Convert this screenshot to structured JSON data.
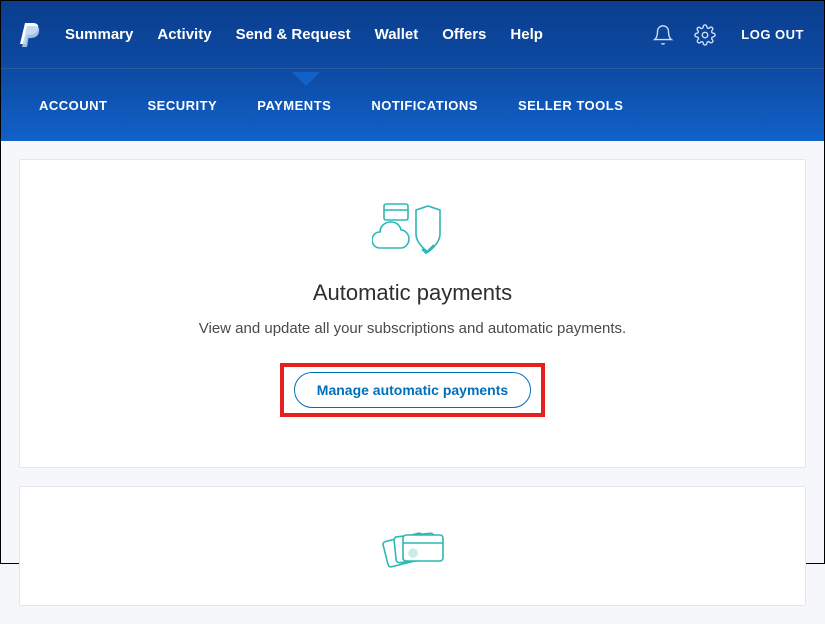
{
  "topNav": {
    "items": [
      "Summary",
      "Activity",
      "Send & Request",
      "Wallet",
      "Offers",
      "Help"
    ],
    "logout": "LOG OUT"
  },
  "subNav": {
    "items": [
      "ACCOUNT",
      "SECURITY",
      "PAYMENTS",
      "NOTIFICATIONS",
      "SELLER TOOLS"
    ],
    "activeIndex": 2
  },
  "card": {
    "title": "Automatic payments",
    "description": "View and update all your subscriptions and automatic payments.",
    "buttonLabel": "Manage automatic payments"
  }
}
